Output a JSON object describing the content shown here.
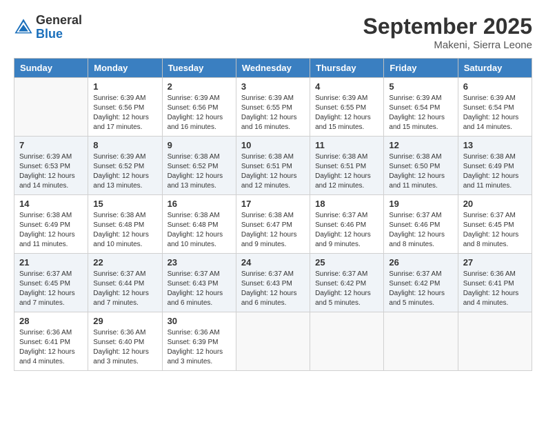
{
  "logo": {
    "general": "General",
    "blue": "Blue"
  },
  "title": {
    "month_year": "September 2025",
    "location": "Makeni, Sierra Leone"
  },
  "headers": [
    "Sunday",
    "Monday",
    "Tuesday",
    "Wednesday",
    "Thursday",
    "Friday",
    "Saturday"
  ],
  "weeks": [
    [
      {
        "day": "",
        "info": ""
      },
      {
        "day": "1",
        "info": "Sunrise: 6:39 AM\nSunset: 6:56 PM\nDaylight: 12 hours\nand 17 minutes."
      },
      {
        "day": "2",
        "info": "Sunrise: 6:39 AM\nSunset: 6:56 PM\nDaylight: 12 hours\nand 16 minutes."
      },
      {
        "day": "3",
        "info": "Sunrise: 6:39 AM\nSunset: 6:55 PM\nDaylight: 12 hours\nand 16 minutes."
      },
      {
        "day": "4",
        "info": "Sunrise: 6:39 AM\nSunset: 6:55 PM\nDaylight: 12 hours\nand 15 minutes."
      },
      {
        "day": "5",
        "info": "Sunrise: 6:39 AM\nSunset: 6:54 PM\nDaylight: 12 hours\nand 15 minutes."
      },
      {
        "day": "6",
        "info": "Sunrise: 6:39 AM\nSunset: 6:54 PM\nDaylight: 12 hours\nand 14 minutes."
      }
    ],
    [
      {
        "day": "7",
        "info": "Sunrise: 6:39 AM\nSunset: 6:53 PM\nDaylight: 12 hours\nand 14 minutes."
      },
      {
        "day": "8",
        "info": "Sunrise: 6:39 AM\nSunset: 6:52 PM\nDaylight: 12 hours\nand 13 minutes."
      },
      {
        "day": "9",
        "info": "Sunrise: 6:38 AM\nSunset: 6:52 PM\nDaylight: 12 hours\nand 13 minutes."
      },
      {
        "day": "10",
        "info": "Sunrise: 6:38 AM\nSunset: 6:51 PM\nDaylight: 12 hours\nand 12 minutes."
      },
      {
        "day": "11",
        "info": "Sunrise: 6:38 AM\nSunset: 6:51 PM\nDaylight: 12 hours\nand 12 minutes."
      },
      {
        "day": "12",
        "info": "Sunrise: 6:38 AM\nSunset: 6:50 PM\nDaylight: 12 hours\nand 11 minutes."
      },
      {
        "day": "13",
        "info": "Sunrise: 6:38 AM\nSunset: 6:49 PM\nDaylight: 12 hours\nand 11 minutes."
      }
    ],
    [
      {
        "day": "14",
        "info": "Sunrise: 6:38 AM\nSunset: 6:49 PM\nDaylight: 12 hours\nand 11 minutes."
      },
      {
        "day": "15",
        "info": "Sunrise: 6:38 AM\nSunset: 6:48 PM\nDaylight: 12 hours\nand 10 minutes."
      },
      {
        "day": "16",
        "info": "Sunrise: 6:38 AM\nSunset: 6:48 PM\nDaylight: 12 hours\nand 10 minutes."
      },
      {
        "day": "17",
        "info": "Sunrise: 6:38 AM\nSunset: 6:47 PM\nDaylight: 12 hours\nand 9 minutes."
      },
      {
        "day": "18",
        "info": "Sunrise: 6:37 AM\nSunset: 6:46 PM\nDaylight: 12 hours\nand 9 minutes."
      },
      {
        "day": "19",
        "info": "Sunrise: 6:37 AM\nSunset: 6:46 PM\nDaylight: 12 hours\nand 8 minutes."
      },
      {
        "day": "20",
        "info": "Sunrise: 6:37 AM\nSunset: 6:45 PM\nDaylight: 12 hours\nand 8 minutes."
      }
    ],
    [
      {
        "day": "21",
        "info": "Sunrise: 6:37 AM\nSunset: 6:45 PM\nDaylight: 12 hours\nand 7 minutes."
      },
      {
        "day": "22",
        "info": "Sunrise: 6:37 AM\nSunset: 6:44 PM\nDaylight: 12 hours\nand 7 minutes."
      },
      {
        "day": "23",
        "info": "Sunrise: 6:37 AM\nSunset: 6:43 PM\nDaylight: 12 hours\nand 6 minutes."
      },
      {
        "day": "24",
        "info": "Sunrise: 6:37 AM\nSunset: 6:43 PM\nDaylight: 12 hours\nand 6 minutes."
      },
      {
        "day": "25",
        "info": "Sunrise: 6:37 AM\nSunset: 6:42 PM\nDaylight: 12 hours\nand 5 minutes."
      },
      {
        "day": "26",
        "info": "Sunrise: 6:37 AM\nSunset: 6:42 PM\nDaylight: 12 hours\nand 5 minutes."
      },
      {
        "day": "27",
        "info": "Sunrise: 6:36 AM\nSunset: 6:41 PM\nDaylight: 12 hours\nand 4 minutes."
      }
    ],
    [
      {
        "day": "28",
        "info": "Sunrise: 6:36 AM\nSunset: 6:41 PM\nDaylight: 12 hours\nand 4 minutes."
      },
      {
        "day": "29",
        "info": "Sunrise: 6:36 AM\nSunset: 6:40 PM\nDaylight: 12 hours\nand 3 minutes."
      },
      {
        "day": "30",
        "info": "Sunrise: 6:36 AM\nSunset: 6:39 PM\nDaylight: 12 hours\nand 3 minutes."
      },
      {
        "day": "",
        "info": ""
      },
      {
        "day": "",
        "info": ""
      },
      {
        "day": "",
        "info": ""
      },
      {
        "day": "",
        "info": ""
      }
    ]
  ]
}
